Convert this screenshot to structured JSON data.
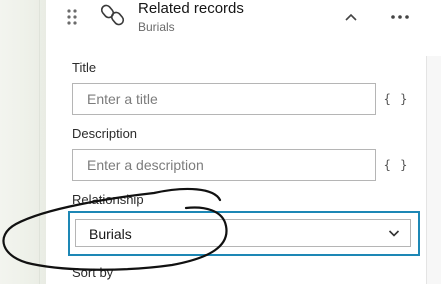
{
  "header": {
    "title": "Related records",
    "subtitle": "Burials",
    "icons": [
      "drag-handle-icon",
      "link-icon",
      "chevron-up-icon",
      "more-icon"
    ]
  },
  "form": {
    "title": {
      "label": "Title",
      "placeholder": "Enter a title",
      "value": ""
    },
    "description": {
      "label": "Description",
      "placeholder": "Enter a description",
      "value": ""
    },
    "expression_button": "{ }",
    "relationship": {
      "label": "Relationship",
      "selected": "Burials"
    },
    "sort_by": {
      "label": "Sort by"
    }
  },
  "colors": {
    "focus_outline": "#1d87b5",
    "input_border": "#b5b5b5",
    "annotation_stroke": "#111111"
  }
}
